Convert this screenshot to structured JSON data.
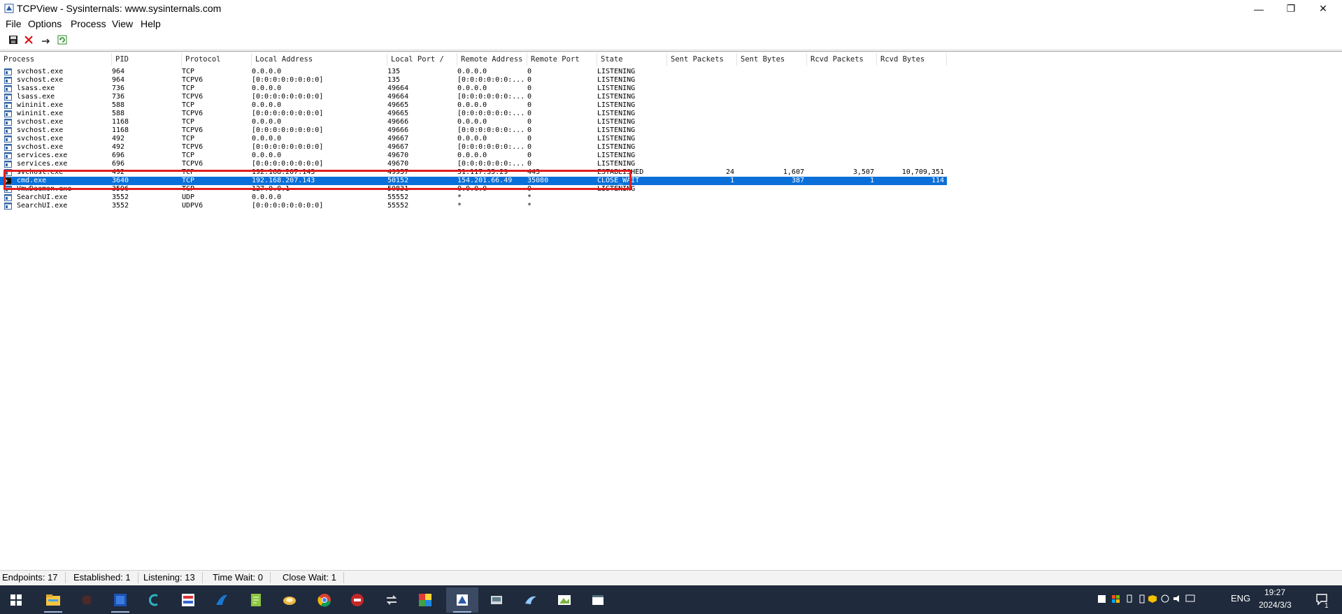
{
  "window": {
    "title": "TCPView - Sysinternals: www.sysinternals.com",
    "minimize_glyph": "—",
    "restore_glyph": "❐",
    "close_glyph": "✕"
  },
  "menu": [
    "File",
    "Options",
    "Process",
    "View",
    "Help"
  ],
  "toolbar": {
    "icons": [
      "save-icon",
      "close-connection-icon",
      "resolve-addresses-icon",
      "refresh-icon"
    ]
  },
  "columns": [
    "Process",
    "PID",
    "Protocol",
    "Local Address",
    "Local Port  /",
    "Remote Address",
    "Remote Port",
    "State",
    "Sent Packets",
    "Sent Bytes",
    "Rcvd Packets",
    "Rcvd Bytes"
  ],
  "rows": [
    {
      "process": "svchost.exe",
      "pid": "964",
      "protocol": "TCP",
      "local_address": "0.0.0.0",
      "local_port": "135",
      "remote_address": "0.0.0.0",
      "remote_port": "0",
      "state": "LISTENING",
      "sent_packets": "",
      "sent_bytes": "",
      "rcvd_packets": "",
      "rcvd_bytes": ""
    },
    {
      "process": "svchost.exe",
      "pid": "964",
      "protocol": "TCPV6",
      "local_address": "[0:0:0:0:0:0:0:0]",
      "local_port": "135",
      "remote_address": "[0:0:0:0:0:0:...",
      "remote_port": "0",
      "state": "LISTENING",
      "sent_packets": "",
      "sent_bytes": "",
      "rcvd_packets": "",
      "rcvd_bytes": ""
    },
    {
      "process": "lsass.exe",
      "pid": "736",
      "protocol": "TCP",
      "local_address": "0.0.0.0",
      "local_port": "49664",
      "remote_address": "0.0.0.0",
      "remote_port": "0",
      "state": "LISTENING",
      "sent_packets": "",
      "sent_bytes": "",
      "rcvd_packets": "",
      "rcvd_bytes": ""
    },
    {
      "process": "lsass.exe",
      "pid": "736",
      "protocol": "TCPV6",
      "local_address": "[0:0:0:0:0:0:0:0]",
      "local_port": "49664",
      "remote_address": "[0:0:0:0:0:0:...",
      "remote_port": "0",
      "state": "LISTENING",
      "sent_packets": "",
      "sent_bytes": "",
      "rcvd_packets": "",
      "rcvd_bytes": ""
    },
    {
      "process": "wininit.exe",
      "pid": "588",
      "protocol": "TCP",
      "local_address": "0.0.0.0",
      "local_port": "49665",
      "remote_address": "0.0.0.0",
      "remote_port": "0",
      "state": "LISTENING",
      "sent_packets": "",
      "sent_bytes": "",
      "rcvd_packets": "",
      "rcvd_bytes": ""
    },
    {
      "process": "wininit.exe",
      "pid": "588",
      "protocol": "TCPV6",
      "local_address": "[0:0:0:0:0:0:0:0]",
      "local_port": "49665",
      "remote_address": "[0:0:0:0:0:0:...",
      "remote_port": "0",
      "state": "LISTENING",
      "sent_packets": "",
      "sent_bytes": "",
      "rcvd_packets": "",
      "rcvd_bytes": ""
    },
    {
      "process": "svchost.exe",
      "pid": "1168",
      "protocol": "TCP",
      "local_address": "0.0.0.0",
      "local_port": "49666",
      "remote_address": "0.0.0.0",
      "remote_port": "0",
      "state": "LISTENING",
      "sent_packets": "",
      "sent_bytes": "",
      "rcvd_packets": "",
      "rcvd_bytes": ""
    },
    {
      "process": "svchost.exe",
      "pid": "1168",
      "protocol": "TCPV6",
      "local_address": "[0:0:0:0:0:0:0:0]",
      "local_port": "49666",
      "remote_address": "[0:0:0:0:0:0:...",
      "remote_port": "0",
      "state": "LISTENING",
      "sent_packets": "",
      "sent_bytes": "",
      "rcvd_packets": "",
      "rcvd_bytes": ""
    },
    {
      "process": "svchost.exe",
      "pid": "492",
      "protocol": "TCP",
      "local_address": "0.0.0.0",
      "local_port": "49667",
      "remote_address": "0.0.0.0",
      "remote_port": "0",
      "state": "LISTENING",
      "sent_packets": "",
      "sent_bytes": "",
      "rcvd_packets": "",
      "rcvd_bytes": ""
    },
    {
      "process": "svchost.exe",
      "pid": "492",
      "protocol": "TCPV6",
      "local_address": "[0:0:0:0:0:0:0:0]",
      "local_port": "49667",
      "remote_address": "[0:0:0:0:0:0:...",
      "remote_port": "0",
      "state": "LISTENING",
      "sent_packets": "",
      "sent_bytes": "",
      "rcvd_packets": "",
      "rcvd_bytes": ""
    },
    {
      "process": "services.exe",
      "pid": "696",
      "protocol": "TCP",
      "local_address": "0.0.0.0",
      "local_port": "49670",
      "remote_address": "0.0.0.0",
      "remote_port": "0",
      "state": "LISTENING",
      "sent_packets": "",
      "sent_bytes": "",
      "rcvd_packets": "",
      "rcvd_bytes": ""
    },
    {
      "process": "services.exe",
      "pid": "696",
      "protocol": "TCPV6",
      "local_address": "[0:0:0:0:0:0:0:0]",
      "local_port": "49670",
      "remote_address": "[0:0:0:0:0:0:...",
      "remote_port": "0",
      "state": "LISTENING",
      "sent_packets": "",
      "sent_bytes": "",
      "rcvd_packets": "",
      "rcvd_bytes": ""
    },
    {
      "process": "svchost.exe",
      "pid": "492",
      "protocol": "TCP",
      "local_address": "192.168.207.143",
      "local_port": "49957",
      "remote_address": "51.117.35.29",
      "remote_port": "443",
      "state": "ESTABLISHED",
      "sent_packets": "24",
      "sent_bytes": "1,607",
      "rcvd_packets": "3,507",
      "rcvd_bytes": "10,709,351"
    },
    {
      "process": "cmd.exe",
      "pid": "3640",
      "protocol": "TCP",
      "local_address": "192.168.207.143",
      "local_port": "50152",
      "remote_address": "154.201.66.49",
      "remote_port": "35080",
      "state": "CLOSE_WAIT",
      "sent_packets": "1",
      "sent_bytes": "387",
      "rcvd_packets": "1",
      "rcvd_bytes": "114",
      "selected": true
    },
    {
      "process": "VmwDaemon.exe",
      "pid": "3596",
      "protocol": "TCP",
      "local_address": "127.0.0.1",
      "local_port": "50831",
      "remote_address": "0.0.0.0",
      "remote_port": "0",
      "state": "LISTENING",
      "sent_packets": "",
      "sent_bytes": "",
      "rcvd_packets": "",
      "rcvd_bytes": ""
    },
    {
      "process": "SearchUI.exe",
      "pid": "3552",
      "protocol": "UDP",
      "local_address": "0.0.0.0",
      "local_port": "55552",
      "remote_address": "*",
      "remote_port": "*",
      "state": "",
      "sent_packets": "",
      "sent_bytes": "",
      "rcvd_packets": "",
      "rcvd_bytes": ""
    },
    {
      "process": "SearchUI.exe",
      "pid": "3552",
      "protocol": "UDPV6",
      "local_address": "[0:0:0:0:0:0:0:0]",
      "local_port": "55552",
      "remote_address": "*",
      "remote_port": "*",
      "state": "",
      "sent_packets": "",
      "sent_bytes": "",
      "rcvd_packets": "",
      "rcvd_bytes": ""
    }
  ],
  "status": {
    "endpoints": "Endpoints: 17",
    "established": "Established: 1",
    "listening": "Listening: 13",
    "time_wait": "Time Wait: 0",
    "close_wait": "Close Wait: 1"
  },
  "taskbar": {
    "apps": [
      "windows-start-icon",
      "file-explorer-icon",
      "app-icon-dark",
      "virtual-machine-icon",
      "c-app-icon",
      "video-app-icon",
      "wireshark-icon",
      "notepad-plus-icon",
      "folder-app-icon",
      "chrome-icon",
      "recorder-app-icon",
      "transfer-app-icon",
      "color-squares-icon",
      "tcpview-icon",
      "sysinternals-icon",
      "shark-blue-icon",
      "paint-app-icon",
      "window-app-icon"
    ],
    "tray_lang": "ENG",
    "time": "19:27",
    "date": "2024/3/3",
    "notification_count": "1"
  },
  "colors": {
    "selection": "#0a6fd8",
    "highlight_box": "#e01e1e",
    "taskbar": "#1f2a3c"
  }
}
